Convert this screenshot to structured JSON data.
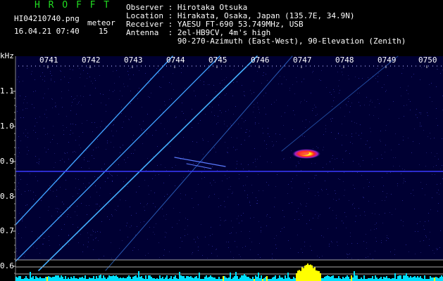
{
  "header": {
    "app_title": "H R O F F T",
    "filename": "HI04210740.png",
    "mode_label": "meteor",
    "timestamp": "16.04.21 07:40",
    "count": "15",
    "info_lines": [
      "Observer : Hirotaka Otsuka",
      "Location : Hirakata, Osaka, Japan (135.7E, 34.9N)",
      "Receiver : YAESU FT-690 53.749MHz, USB",
      "Antenna  : 2el-HB9CV, 4m's high",
      "           90-270-Azimuth (East-West), 90-Elevation (Zenith)"
    ]
  },
  "axes": {
    "y_unit": "kHz",
    "y_ticks": [
      "1.1",
      "1.0",
      "0.9",
      "0.8",
      "0.7",
      "0.6"
    ],
    "x_ticks": [
      "0741",
      "0742",
      "0743",
      "0744",
      "0745",
      "0746",
      "0747",
      "0748",
      "0749",
      "0750"
    ]
  },
  "colors": {
    "background": "#000033",
    "trace": "#3fa0ff",
    "carrier": "#3a3aff",
    "text_white": "#ffffff",
    "title_green": "#22dd22",
    "histogram": "#00e0ff",
    "histogram_peak": "#ffff00"
  }
}
